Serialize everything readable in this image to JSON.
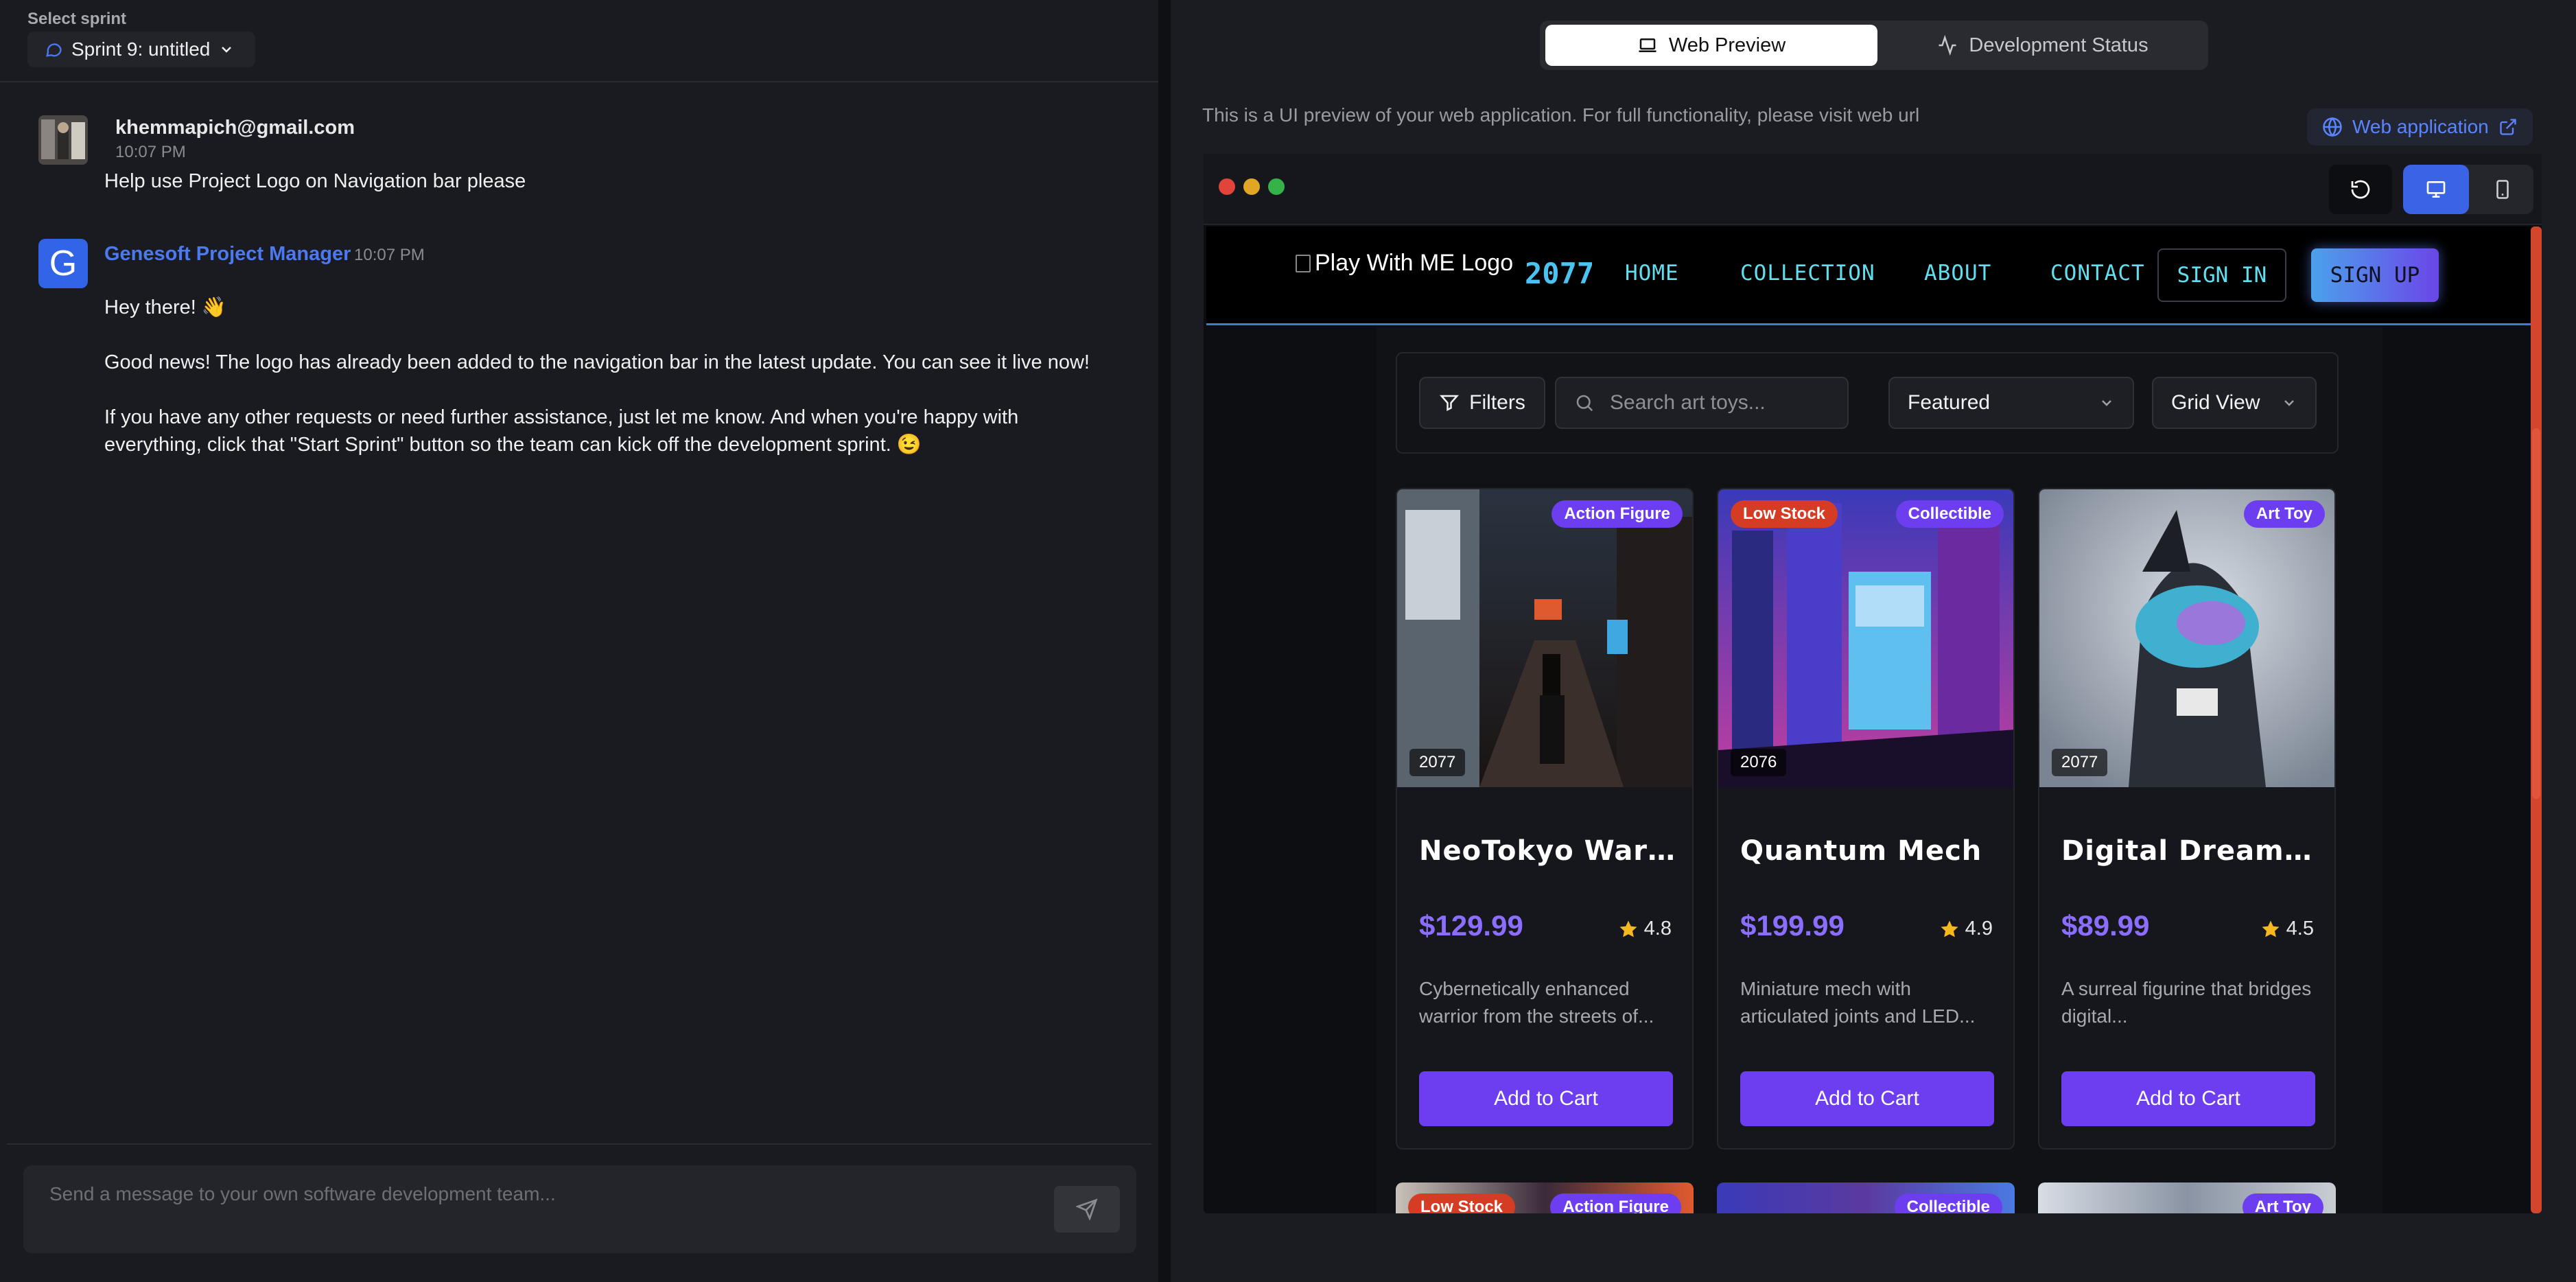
{
  "left": {
    "sprint_caption": "Select sprint",
    "sprint_selected": "Sprint 9: untitled",
    "messages": {
      "user": {
        "email": "khemmapich@gmail.com",
        "time": "10:07 PM",
        "text": "Help use Project Logo on Navigation bar please"
      },
      "bot": {
        "name": "Genesoft Project Manager",
        "time": "10:07 PM",
        "avatar_letter": "G",
        "line1": "Hey there! 👋",
        "line2": "Good news! The logo has already been added to the navigation bar in the latest update. You can see it live now!",
        "line3": "If you have any other requests or need further assistance, just let me know. And when you're happy with everything, click that \"Start Sprint\" button so the team can kick off the development sprint. 😉"
      }
    },
    "composer_placeholder": "Send a message to your own software development team..."
  },
  "right": {
    "tabs": [
      {
        "label": "Web Preview",
        "icon": "laptop-icon",
        "active": true
      },
      {
        "label": "Development Status",
        "icon": "activity-icon",
        "active": false
      }
    ],
    "preview_note": "This is a UI preview of your web application. For full functionality, please visit web url",
    "web_app_button": "Web application",
    "site": {
      "logo_alt": "Play With ME Logo",
      "logo_year": "2077",
      "nav": [
        "HOME",
        "COLLECTION",
        "ABOUT",
        "CONTACT"
      ],
      "sign_in": "SIGN IN",
      "sign_up": "SIGN UP",
      "filters_label": "Filters",
      "search_placeholder": "Search art toys...",
      "sort_value": "Featured",
      "view_value": "Grid View",
      "products": [
        {
          "title": "NeoTokyo Warrior",
          "price": "$129.99",
          "rating": "4.8",
          "year": "2077",
          "badges": [
            "Action Figure"
          ],
          "low_stock": false,
          "desc": "Cybernetically enhanced warrior from the streets of...",
          "button": "Add to Cart"
        },
        {
          "title": "Quantum Mech",
          "price": "$199.99",
          "rating": "4.9",
          "year": "2076",
          "badges": [
            "Collectible"
          ],
          "low_stock": true,
          "low_label": "Low Stock",
          "desc": "Miniature mech with articulated joints and LED...",
          "button": "Add to Cart"
        },
        {
          "title": "Digital Dreamweaver",
          "price": "$89.99",
          "rating": "4.5",
          "year": "2077",
          "badges": [
            "Art Toy"
          ],
          "low_stock": false,
          "desc": "A surreal figurine that bridges digital...",
          "button": "Add to Cart"
        }
      ],
      "row2_badges": [
        {
          "low": "Low Stock",
          "cat": "Action Figure"
        },
        {
          "cat": "Collectible"
        },
        {
          "cat": "Art Toy"
        }
      ]
    }
  },
  "colors": {
    "accent_blue": "#3b63e6",
    "brand_purple": "#6d3ef0",
    "low_stock_red": "#d43c24",
    "nav_cyan": "#60dff0",
    "scrollbar": "#d3452c"
  }
}
